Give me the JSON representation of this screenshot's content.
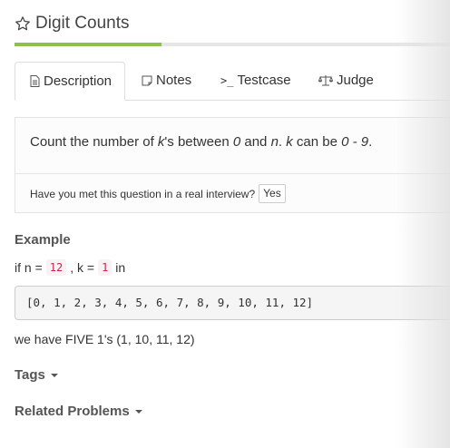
{
  "problem": {
    "title": "Digit Counts",
    "star_icon": "star-outline-icon",
    "progress_percent": 33
  },
  "tabs": [
    {
      "label": "Description",
      "icon": "document-icon",
      "active": true
    },
    {
      "label": "Notes",
      "icon": "note-icon",
      "active": false
    },
    {
      "label": "Testcase",
      "icon": ">_",
      "active": false
    },
    {
      "label": "Judge",
      "icon": "balance-scale-icon",
      "active": false
    }
  ],
  "description": {
    "part1": "Count the number of ",
    "k1": "k",
    "part2": "'s between ",
    "zero": "0",
    "part3": " and ",
    "n": "n",
    "part4": ". ",
    "k2": "k",
    "part5": " can be ",
    "range": "0 - 9",
    "part6": ".",
    "interview_question": "Have you met this question in a real interview?",
    "yes_label": "Yes"
  },
  "example": {
    "heading": "Example",
    "prefix": "if n =",
    "n_value": "12",
    "k_label": ", k =",
    "k_value": "1",
    "suffix": "in",
    "sequence": "[0, 1, 2, 3, 4, 5, 6, 7, 8, 9, 10, 11, 12]",
    "result": "we have FIVE 1's (1, 10, 11, 12)"
  },
  "sections": {
    "tags": "Tags",
    "related": "Related Problems"
  },
  "colors": {
    "progress": "#8bc34a",
    "code_text": "#c7254e",
    "code_bg": "#f9f2f4"
  }
}
